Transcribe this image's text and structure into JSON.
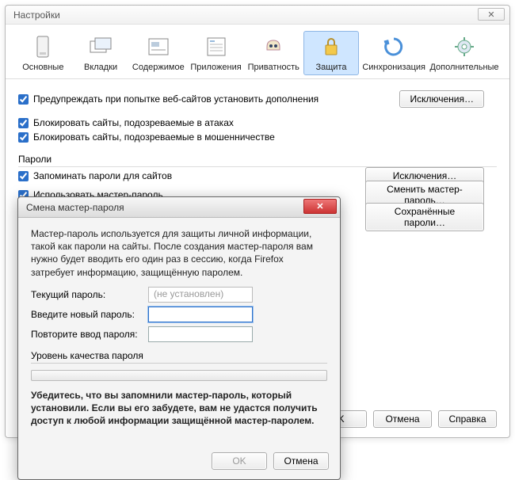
{
  "window": {
    "title": "Настройки"
  },
  "toolbar": {
    "items": [
      {
        "label": "Основные"
      },
      {
        "label": "Вкладки"
      },
      {
        "label": "Содержимое"
      },
      {
        "label": "Приложения"
      },
      {
        "label": "Приватность"
      },
      {
        "label": "Защита"
      },
      {
        "label": "Синхронизация"
      },
      {
        "label": "Дополнительные"
      }
    ]
  },
  "security": {
    "warn_addons": "Предупреждать при попытке веб-сайтов установить дополнения",
    "block_attack": "Блокировать сайты, подозреваемые в атаках",
    "block_fraud": "Блокировать сайты, подозреваемые в мошенничестве",
    "exceptions_btn": "Исключения…"
  },
  "passwords": {
    "group_label": "Пароли",
    "remember": "Запоминать пароли для сайтов",
    "use_master": "Использовать мастер-пароль",
    "exceptions_btn": "Исключения…",
    "change_master_btn": "Сменить мастер-пароль…",
    "saved_btn": "Сохранённые пароли…"
  },
  "footer": {
    "ok": "OK",
    "cancel": "Отмена",
    "help": "Справка"
  },
  "dialog": {
    "title": "Смена мастер-пароля",
    "intro": "Мастер-пароль используется для защиты личной информации, такой как пароли на сайты. После создания мастер-пароля вам нужно будет вводить его один раз в сессию, когда Firefox затребует информацию, защищённую паролем.",
    "current_label": "Текущий пароль:",
    "current_placeholder": "(не установлен)",
    "new_label": "Введите новый пароль:",
    "repeat_label": "Повторите ввод пароля:",
    "quality_label": "Уровень качества пароля",
    "warning": "Убедитесь, что вы запомнили мастер-пароль, который установили. Если вы его забудете, вам не удастся получить доступ к любой информации защищённой мастер-паролем.",
    "ok": "OK",
    "cancel": "Отмена"
  }
}
